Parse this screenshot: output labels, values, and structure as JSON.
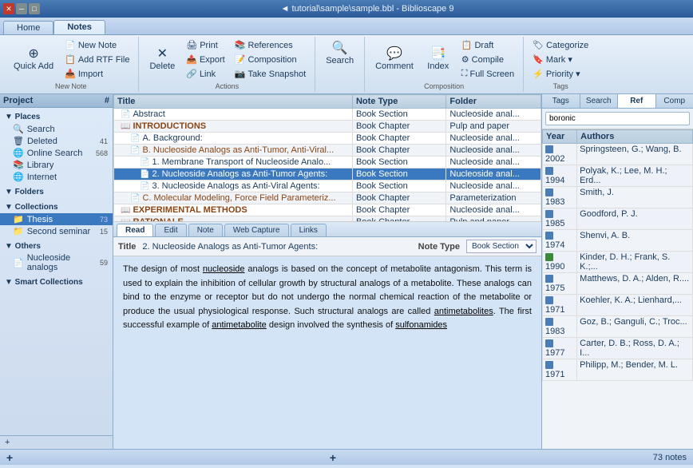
{
  "titleBar": {
    "title": "◄ tutorial\\sample\\sample.bbl - Biblioscape 9",
    "icons": [
      "✕",
      "─",
      "□"
    ]
  },
  "mainTabs": [
    {
      "id": "home",
      "label": "Home"
    },
    {
      "id": "notes",
      "label": "Notes"
    }
  ],
  "activeMainTab": "notes",
  "ribbon": {
    "groups": [
      {
        "label": "New Note",
        "buttons": [
          {
            "id": "quick-add",
            "label": "Quick\nAdd",
            "icon": "⊕",
            "large": true
          },
          {
            "id": "new-note",
            "label": "New Note",
            "icon": "📄",
            "small": true
          },
          {
            "id": "add-rtf",
            "label": "Add RTF File",
            "icon": "📋",
            "small": true
          },
          {
            "id": "import",
            "label": "Import",
            "icon": "📥",
            "small": true
          }
        ]
      },
      {
        "label": "Actions",
        "buttons": [
          {
            "id": "delete",
            "label": "Delete",
            "icon": "✕",
            "large": true
          },
          {
            "id": "print",
            "label": "Print",
            "small": true
          },
          {
            "id": "export",
            "label": "Export",
            "small": true
          },
          {
            "id": "link",
            "label": "Link",
            "small": true
          },
          {
            "id": "references",
            "label": "References",
            "small": true
          },
          {
            "id": "composition",
            "label": "Composition",
            "small": true
          },
          {
            "id": "take-snapshot",
            "label": "Take Snapshot",
            "small": true
          }
        ]
      },
      {
        "label": "",
        "buttons": [
          {
            "id": "search-ribbon",
            "label": "Search",
            "icon": "🔍",
            "large": true
          }
        ]
      },
      {
        "label": "Composition",
        "buttons": [
          {
            "id": "comment",
            "label": "Comment",
            "icon": "💬",
            "large": true
          },
          {
            "id": "index",
            "label": "Index",
            "icon": "📑",
            "large": true
          },
          {
            "id": "draft",
            "label": "Draft",
            "small": true
          },
          {
            "id": "compile",
            "label": "Compile",
            "small": true
          },
          {
            "id": "full-screen",
            "label": "Full Screen",
            "small": true
          }
        ]
      },
      {
        "label": "Tags",
        "buttons": [
          {
            "id": "categorize",
            "label": "Categorize",
            "small": true
          },
          {
            "id": "mark",
            "label": "Mark ▾",
            "small": true
          },
          {
            "id": "priority",
            "label": "Priority ▾",
            "small": true
          }
        ]
      }
    ]
  },
  "sidebar": {
    "header": "Project",
    "sections": [
      {
        "label": "Places",
        "items": [
          {
            "id": "search",
            "label": "Search",
            "icon": "🔍",
            "count": ""
          },
          {
            "id": "deleted",
            "label": "Deleted",
            "icon": "🗑",
            "count": "41"
          },
          {
            "id": "online-search",
            "label": "Online Search",
            "icon": "🌐",
            "count": "568"
          },
          {
            "id": "library",
            "label": "Library",
            "icon": "📚",
            "count": ""
          },
          {
            "id": "internet",
            "label": "Internet",
            "icon": "🌐",
            "count": ""
          }
        ]
      },
      {
        "label": "Folders",
        "items": []
      },
      {
        "label": "Collections",
        "items": [
          {
            "id": "thesis",
            "label": "Thesis",
            "icon": "📁",
            "count": "73",
            "active": true
          },
          {
            "id": "second-seminar",
            "label": "Second seminar",
            "icon": "📁",
            "count": "15"
          }
        ]
      },
      {
        "label": "Others",
        "items": [
          {
            "id": "nucleoside-analogs",
            "label": "Nucleoside analogs",
            "icon": "📄",
            "count": "59"
          }
        ]
      },
      {
        "label": "Smart Collections",
        "items": []
      }
    ],
    "addButton": "+"
  },
  "tableHeader": {
    "columns": [
      "Title",
      "Note Type",
      "Folder"
    ]
  },
  "tableRows": [
    {
      "id": 1,
      "indent": 1,
      "icon": "📄",
      "title": "Abstract",
      "noteType": "Book Section",
      "folder": "Nucleoside anal...",
      "selected": false
    },
    {
      "id": 2,
      "indent": 1,
      "icon": "📖",
      "title": "INTRODUCTIONS",
      "noteType": "Book Chapter",
      "folder": "Pulp and paper",
      "selected": false,
      "bold": true,
      "color": "#8b4513"
    },
    {
      "id": 3,
      "indent": 2,
      "icon": "📄",
      "title": "A. Background:",
      "noteType": "Book Chapter",
      "folder": "Nucleoside anal...",
      "selected": false
    },
    {
      "id": 4,
      "indent": 2,
      "icon": "📄",
      "title": "B. Nucleoside Analogs as Anti-Tumor, Anti-Viral...",
      "noteType": "Book Chapter",
      "folder": "Nucleoside anal...",
      "selected": false,
      "color": "#8b4513"
    },
    {
      "id": 5,
      "indent": 3,
      "icon": "📄",
      "title": "1. Membrane Transport of Nucleoside Analo...",
      "noteType": "Book Section",
      "folder": "Nucleoside anal...",
      "selected": false
    },
    {
      "id": 6,
      "indent": 3,
      "icon": "📄",
      "title": "2. Nucleoside Analogs as Anti-Tumor Agents:",
      "noteType": "Book Section",
      "folder": "Nucleoside anal...",
      "selected": true
    },
    {
      "id": 7,
      "indent": 3,
      "icon": "📄",
      "title": "3. Nucleoside Analogs as Anti-Viral Agents:",
      "noteType": "Book Section",
      "folder": "Nucleoside anal...",
      "selected": false
    },
    {
      "id": 8,
      "indent": 2,
      "icon": "📄",
      "title": "C. Molecular Modeling, Force Field Parameteriz...",
      "noteType": "Book Chapter",
      "folder": "Parameterization",
      "selected": false,
      "color": "#8b4513"
    },
    {
      "id": 9,
      "indent": 1,
      "icon": "📖",
      "title": "EXPERIMENTAL METHODS",
      "noteType": "Book Chapter",
      "folder": "Nucleoside anal...",
      "selected": false,
      "bold": true,
      "color": "#8b4513"
    },
    {
      "id": 10,
      "indent": 1,
      "icon": "📖",
      "title": "RATIONALE",
      "noteType": "Book Chapter",
      "folder": "Pulp and paper",
      "selected": false,
      "bold": true,
      "color": "#8b4513"
    }
  ],
  "detailTabs": [
    "Read",
    "Edit",
    "Note",
    "Web Capture",
    "Links"
  ],
  "activeDetailTab": "Read",
  "detailHeader": {
    "titleLabel": "Title",
    "titleValue": "2. Nucleoside Analogs as Anti-Tumor Agents:",
    "noteTypeLabel": "Note Type",
    "noteTypeValue": "Book Section"
  },
  "detailContent": "The design of most nucleoside analogs is based on the concept of metabolite antagonism. This term is used to explain the inhibition of cellular growth by structural analogs of a metabolite. These analogs can bind to the enzyme or receptor but do not undergo the normal chemical reaction of the metabolite or produce the usual physiological response. Such structural analogs are called antimetabolites. The first successful example of antimetabolite design involved the synthesis of sulfonamides",
  "rightPanel": {
    "tabs": [
      "Tags",
      "Search",
      "Ref",
      "Comp"
    ],
    "activeTab": "Ref",
    "searchValue": "boronic",
    "searchPlaceholder": "boronic",
    "columns": [
      "Year",
      "Authors"
    ],
    "rows": [
      {
        "year": "2002",
        "authors": "Springsteen, G.; Wang, B.",
        "iconColor": "blue"
      },
      {
        "year": "1994",
        "authors": "Polyak, K.; Lee, M. H.; Erd...",
        "iconColor": "blue"
      },
      {
        "year": "1983",
        "authors": "Smith, J.",
        "iconColor": "blue"
      },
      {
        "year": "1985",
        "authors": "Goodford, P. J.",
        "iconColor": "blue"
      },
      {
        "year": "1974",
        "authors": "Shenvi, A. B.",
        "iconColor": "blue"
      },
      {
        "year": "1990",
        "authors": "Kinder, D. H.; Frank, S. K.;...",
        "iconColor": "green"
      },
      {
        "year": "1975",
        "authors": "Matthews, D. A.; Alden, R....",
        "iconColor": "blue"
      },
      {
        "year": "1971",
        "authors": "Koehler, K. A.; Lienhard,...",
        "iconColor": "blue"
      },
      {
        "year": "1983",
        "authors": "Goz, B.; Ganguli, C.; Troc...",
        "iconColor": "blue"
      },
      {
        "year": "1977",
        "authors": "Carter, D. B.; Ross, D. A.; I...",
        "iconColor": "blue"
      },
      {
        "year": "1971",
        "authors": "Philipp, M.; Bender, M. L.",
        "iconColor": "blue"
      }
    ]
  },
  "statusBar": {
    "addLabel": "+",
    "addLabel2": "+",
    "noteCount": "73 notes"
  }
}
